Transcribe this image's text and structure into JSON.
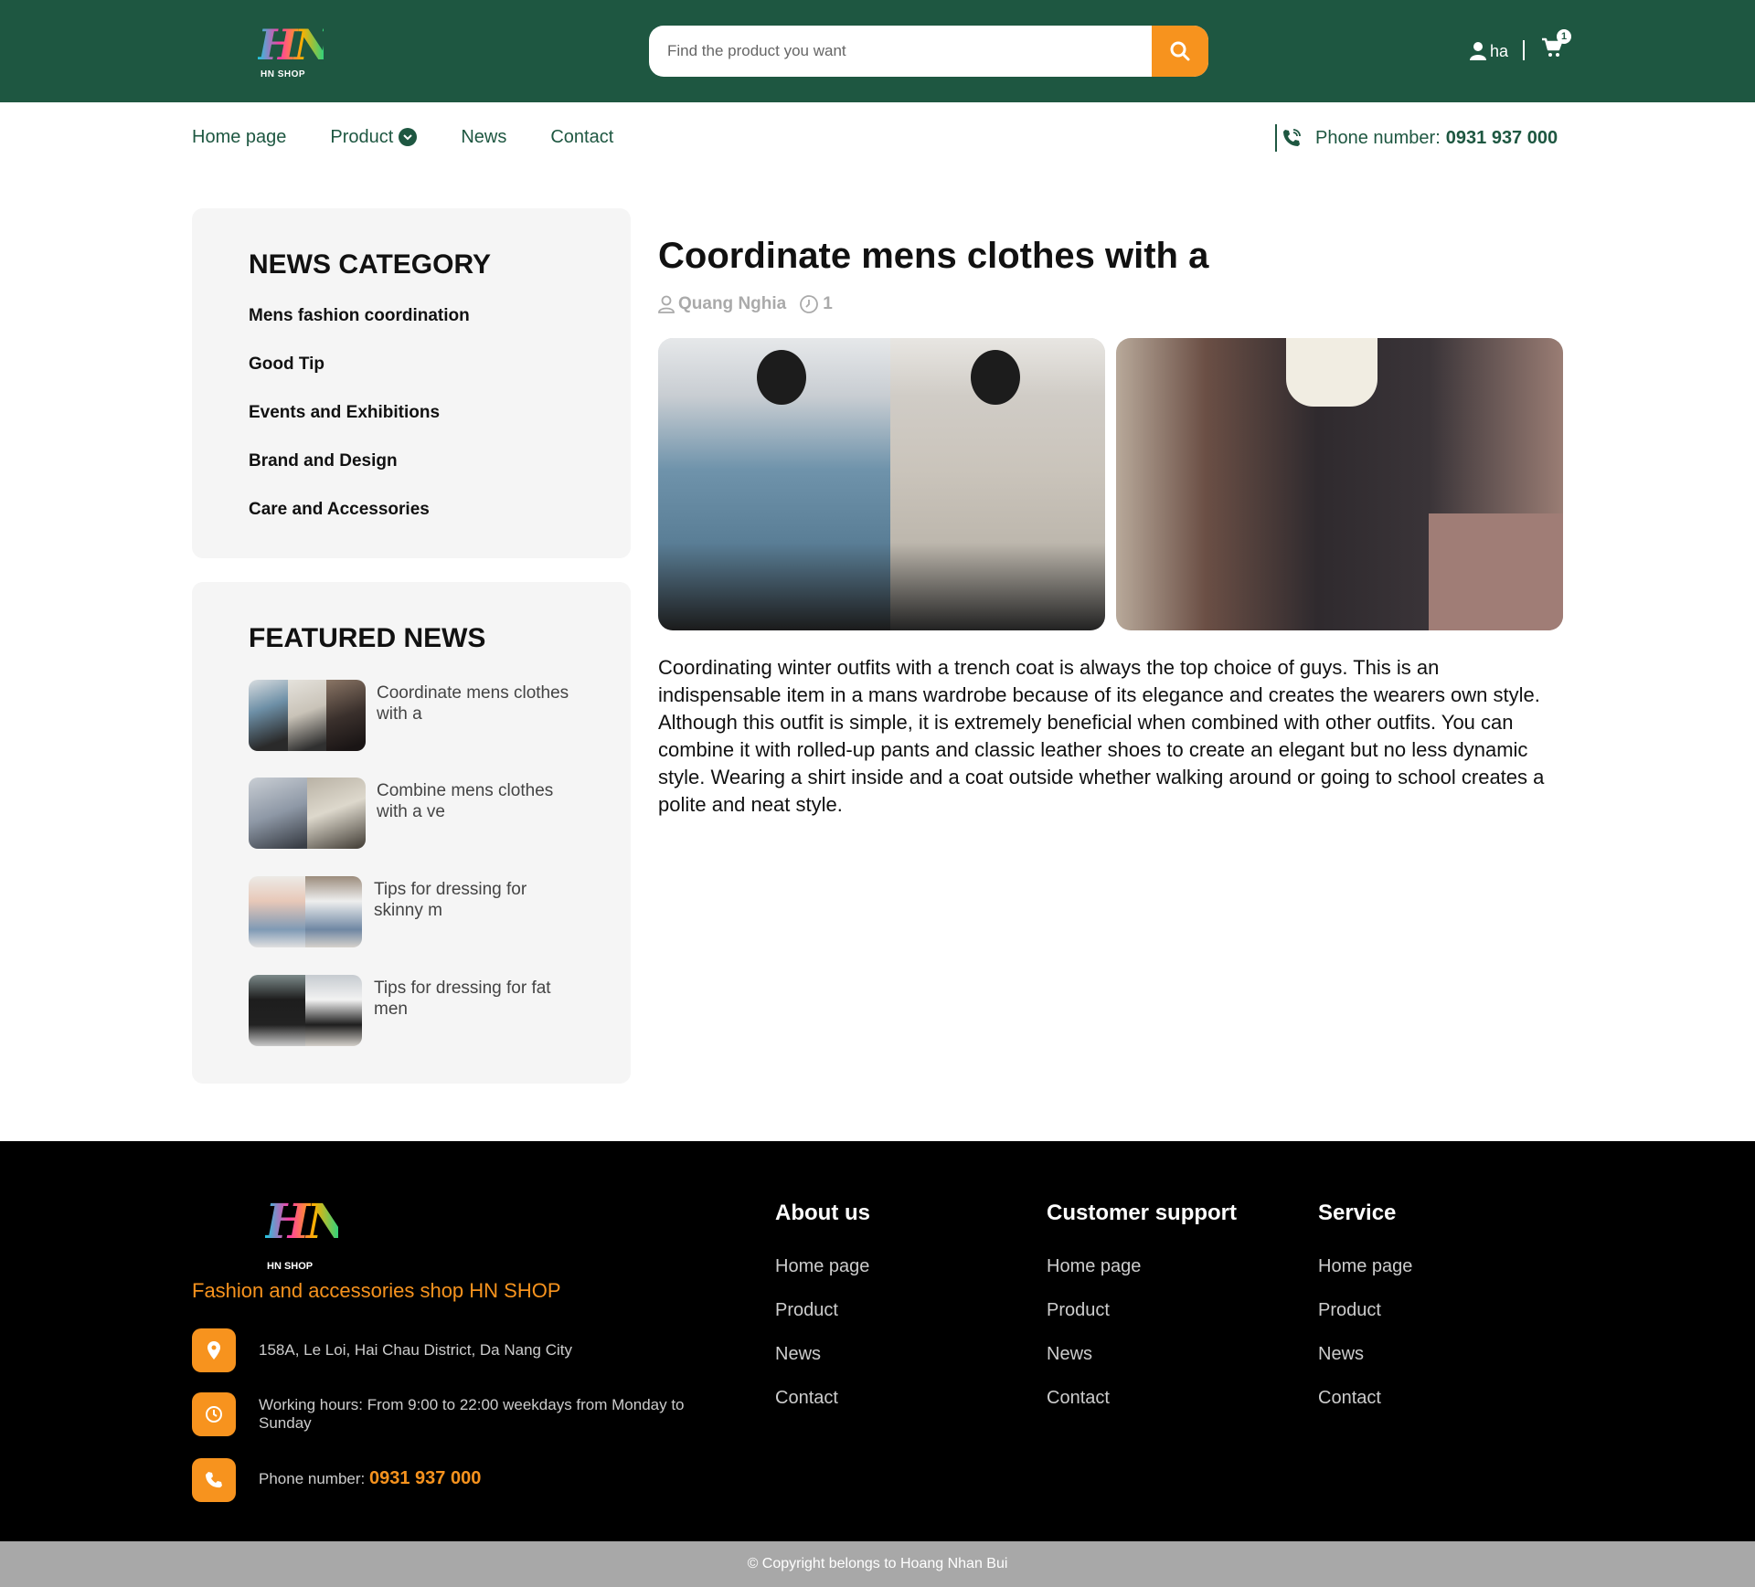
{
  "header": {
    "logo_text": "HN",
    "logo_sub": "HN SHOP",
    "search_placeholder": "Find the product you want",
    "username": "ha",
    "cart_count": "1",
    "brand_color": "#1e5741",
    "accent_color": "#f7931e"
  },
  "nav": {
    "items": [
      "Home page",
      "Product",
      "News",
      "Contact"
    ],
    "phone_label": "Phone number:",
    "phone_number": "0931 937 000"
  },
  "sidebar": {
    "category_heading": "NEWS CATEGORY",
    "categories": [
      "Mens fashion coordination",
      "Good Tip",
      "Events and Exhibitions",
      "Brand and Design",
      "Care and Accessories"
    ],
    "featured_heading": "FEATURED NEWS",
    "featured": [
      {
        "title": "Coordinate mens clothes with a"
      },
      {
        "title": "Combine mens clothes with a ve"
      },
      {
        "title": "Tips for dressing for skinny m"
      },
      {
        "title": "Tips for dressing for fat men"
      }
    ]
  },
  "article": {
    "title": "Coordinate mens clothes with a",
    "author": "Quang Nghia",
    "views": "1",
    "body": "Coordinating winter outfits with a trench coat is always the top choice of guys. This is an indispensable item in a mans wardrobe because of its elegance and creates the wearers own style. Although this outfit is simple, it is extremely beneficial when combined with other outfits. You can combine it with rolled-up pants and classic leather shoes to create an elegant but no less dynamic style. Wearing a shirt inside and a coat outside whether walking around or going to school creates a polite and neat style."
  },
  "footer": {
    "logo_text": "HN",
    "logo_sub": "HN SHOP",
    "tagline": "Fashion and accessories shop HN SHOP",
    "address": "158A, Le Loi, Hai Chau District, Da Nang City",
    "hours": "Working hours: From 9:00 to 22:00 weekdays from Monday to Sunday",
    "phone_label": "Phone number:",
    "phone_number": "0931 937 000",
    "columns": [
      {
        "heading": "About us",
        "links": [
          "Home page",
          "Product",
          "News",
          "Contact"
        ]
      },
      {
        "heading": "Customer support",
        "links": [
          "Home page",
          "Product",
          "News",
          "Contact"
        ]
      },
      {
        "heading": "Service",
        "links": [
          "Home page",
          "Product",
          "News",
          "Contact"
        ]
      }
    ],
    "copyright": "© Copyright belongs to Hoang Nhan Bui"
  }
}
